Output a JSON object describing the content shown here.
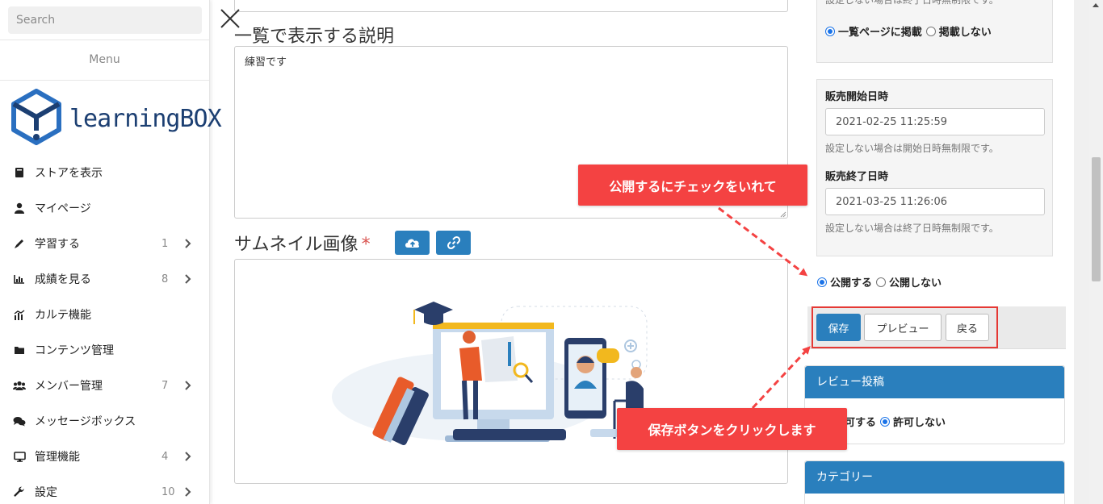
{
  "sidebar": {
    "search_placeholder": "Search",
    "menu_title": "Menu",
    "logo_text": "learningBOX",
    "items": [
      {
        "label": "ストアを表示",
        "count": "",
        "has_chevron": false
      },
      {
        "label": "マイページ",
        "count": "",
        "has_chevron": false
      },
      {
        "label": "学習する",
        "count": "1",
        "has_chevron": true
      },
      {
        "label": "成績を見る",
        "count": "8",
        "has_chevron": true
      },
      {
        "label": "カルテ機能",
        "count": "",
        "has_chevron": false
      },
      {
        "label": "コンテンツ管理",
        "count": "",
        "has_chevron": false
      },
      {
        "label": "メンバー管理",
        "count": "7",
        "has_chevron": true
      },
      {
        "label": "メッセージボックス",
        "count": "",
        "has_chevron": false
      },
      {
        "label": "管理機能",
        "count": "4",
        "has_chevron": true
      },
      {
        "label": "設定",
        "count": "10",
        "has_chevron": true
      }
    ],
    "icons": [
      "book-icon",
      "user-icon",
      "pencil-icon",
      "bar-chart-icon",
      "chart-icon",
      "folder-icon",
      "users-icon",
      "comments-icon",
      "desktop-icon",
      "wrench-icon"
    ]
  },
  "main": {
    "description_title": "一覧で表示する説明",
    "description_value": "練習です",
    "thumbnail_title": "サムネイル画像",
    "required_mark": "*"
  },
  "right": {
    "listing_help": "設定しない場合は終了日時無制限です。",
    "listing_on": "一覧ページに掲載",
    "listing_off": "掲載しない",
    "sale_start_label": "販売開始日時",
    "sale_start_value": "2021-02-25 11:25:59",
    "sale_start_help": "設定しない場合は開始日時無制限です。",
    "sale_end_label": "販売終了日時",
    "sale_end_value": "2021-03-25 11:26:06",
    "sale_end_help": "設定しない場合は終了日時無制限です。",
    "publish_on": "公開する",
    "publish_off": "公開しない",
    "save": "保存",
    "preview": "プレビュー",
    "back": "戻る",
    "review_title": "レビュー投稿",
    "review_allow": "許可する",
    "review_disallow": "許可しない",
    "category_title": "カテゴリー"
  },
  "callouts": {
    "publish": "公開するにチェックをいれて",
    "save": "保存ボタンをクリックします"
  },
  "colors": {
    "accent": "#2a7fbd",
    "callout": "#f44242",
    "highlight": "#e53935",
    "logo": "#1c3f72"
  }
}
